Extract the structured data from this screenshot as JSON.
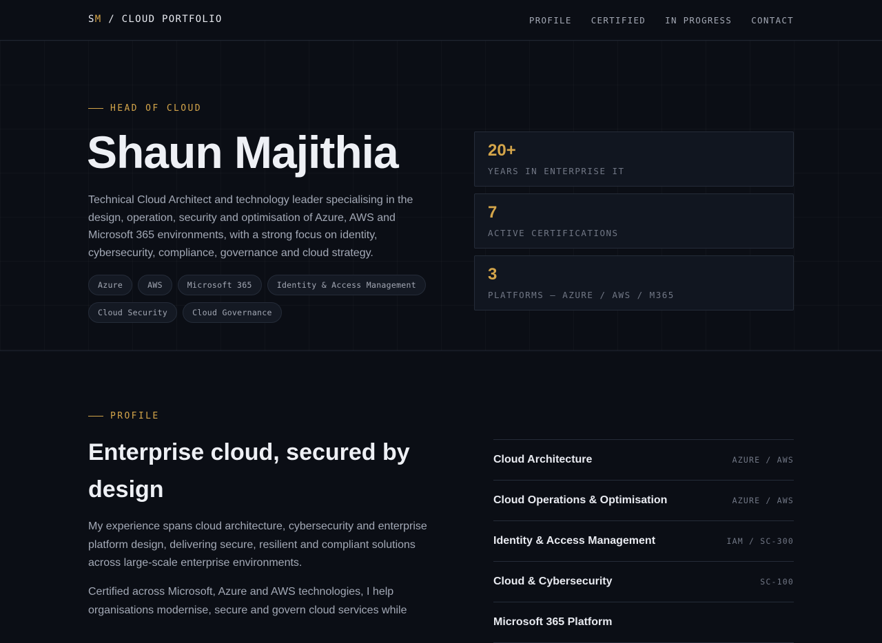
{
  "nav": {
    "brand_initial_1": "S",
    "brand_initial_2": "M",
    "brand_rest": " / CLOUD PORTFOLIO",
    "links": [
      "PROFILE",
      "CERTIFIED",
      "IN PROGRESS",
      "CONTACT"
    ]
  },
  "hero": {
    "eyebrow": "HEAD OF CLOUD",
    "name": "Shaun Majithia",
    "description": "Technical Cloud Architect and technology leader specialising in the design, operation, security and optimisation of Azure, AWS and Microsoft 365 environments, with a strong focus on identity, cybersecurity, compliance, governance and cloud strategy.",
    "tags": [
      "Azure",
      "AWS",
      "Microsoft 365",
      "Identity & Access Management",
      "Cloud Security",
      "Cloud Governance"
    ],
    "stats": [
      {
        "value": "20+",
        "label": "YEARS IN ENTERPRISE IT"
      },
      {
        "value": "7",
        "label": "ACTIVE CERTIFICATIONS"
      },
      {
        "value": "3",
        "label": "PLATFORMS — AZURE / AWS / M365"
      }
    ]
  },
  "profile": {
    "eyebrow": "PROFILE",
    "title": "Enterprise cloud, secured by design",
    "paragraph_1": "My experience spans cloud architecture, cybersecurity and enterprise platform design, delivering secure, resilient and compliant solutions across large-scale enterprise environments.",
    "paragraph_2": "Certified across Microsoft, Azure and AWS technologies, I help organisations modernise, secure and govern cloud services while",
    "skills": [
      {
        "name": "Cloud Architecture",
        "tag": "AZURE / AWS"
      },
      {
        "name": "Cloud Operations & Optimisation",
        "tag": "AZURE / AWS"
      },
      {
        "name": "Identity & Access Management",
        "tag": "IAM / SC-300"
      },
      {
        "name": "Cloud & Cybersecurity",
        "tag": "SC-100"
      },
      {
        "name": "Microsoft 365 Platform",
        "tag": ""
      }
    ]
  },
  "colors": {
    "background": "#0b0e15",
    "accent": "#d4a54a",
    "text": "#eef0f5",
    "muted": "#a3a9b6",
    "border": "#252c39"
  }
}
